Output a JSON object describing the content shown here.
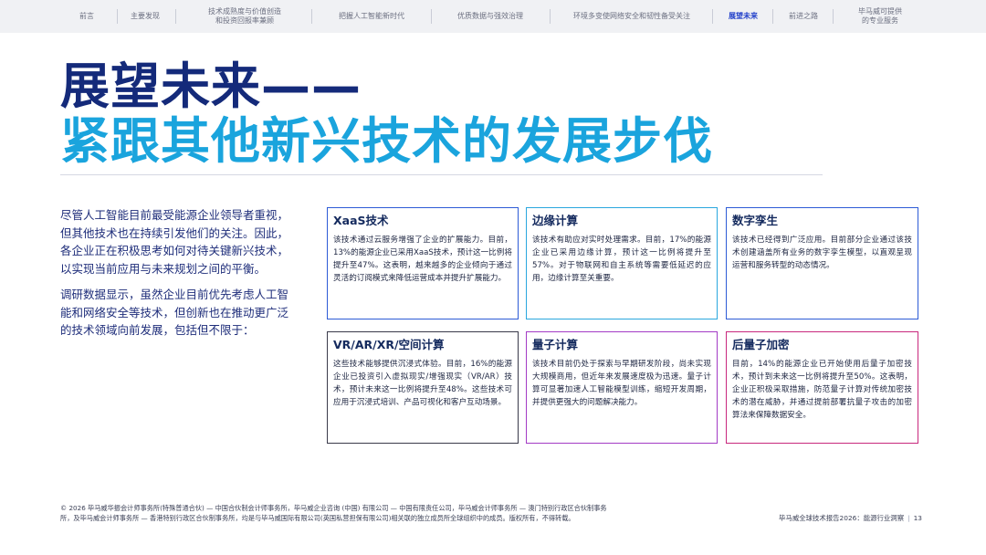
{
  "nav": {
    "items": [
      {
        "label": "前言",
        "active": false
      },
      {
        "label": "主要发现",
        "active": false
      },
      {
        "label": "技术成熟度与价值创造\n和投资回报率兼顾",
        "active": false
      },
      {
        "label": "把握人工智能新时代",
        "active": false
      },
      {
        "label": "优质数据与强效治理",
        "active": false
      },
      {
        "label": "环境多变使网络安全和韧性备受关注",
        "active": false
      },
      {
        "label": "展望未来",
        "active": true
      },
      {
        "label": "前进之路",
        "active": false
      },
      {
        "label": "毕马威可提供\n的专业服务",
        "active": false
      }
    ]
  },
  "heading": {
    "line1": "展望未来——",
    "line2": "紧跟其他新兴技术的发展步伐"
  },
  "intro": {
    "p1": "尽管人工智能目前最受能源企业领导者重视，但其他技术也在持续引发他们的关注。因此，各企业正在积极思考如何对待关键新兴技术，以实现当前应用与未来规划之间的平衡。",
    "p2": "调研数据显示，虽然企业目前优先考虑人工智能和网络安全等技术，但创新也在推动更广泛的技术领域向前发展，包括但不限于："
  },
  "cards": {
    "xaas": {
      "title": "XaaS技术",
      "body": "该技术通过云服务增强了企业的扩展能力。目前，13%的能源企业已采用XaaS技术，预计这一比例将提升至47%。这表明，越来越多的企业倾向于通过灵活的订阅模式来降低运营成本并提升扩展能力。"
    },
    "edge": {
      "title": "边缘计算",
      "body": "该技术有助应对实时处理需求。目前，17%的能源企业已采用边缘计算，预计这一比例将提升至57%。对于物联网和自主系统等需要低延迟的应用，边缘计算至关重要。"
    },
    "twin": {
      "title": "数字孪生",
      "body": "该技术已经得到广泛应用。目前部分企业通过该技术创建涵盖所有业务的数字孪生模型，以直观呈现运营和服务转型的动态情况。"
    },
    "vr": {
      "title": "VR/AR/XR/空间计算",
      "body": "这些技术能够提供沉浸式体验。目前，16%的能源企业已投资引入虚拟现实/增强现实（VR/AR）技术，预计未来这一比例将提升至48%。这些技术可应用于沉浸式培训、产品可视化和客户互动场景。"
    },
    "qc": {
      "title": "量子计算",
      "body": "该技术目前仍处于探索与早期研发阶段，尚未实现大规模商用，但近年来发展速度极为迅速。量子计算可显著加速人工智能模型训练，缩短开发周期，并提供更强大的问题解决能力。"
    },
    "pq": {
      "title": "后量子加密",
      "body": "目前，14%的能源企业已开始使用后量子加密技术，预计到未来这一比例将提升至50%。这表明，企业正积极采取措施，防范量子计算对传统加密技术的潜在威胁，并通过提前部署抗量子攻击的加密算法来保障数据安全。"
    }
  },
  "footer": {
    "legal": "© 2026 毕马威华振会计师事务所(特殊普通合伙) — 中国合伙制会计师事务所，毕马威企业咨询 (中国) 有限公司 — 中国有限责任公司，毕马威会计师事务所 — 澳门特别行政区合伙制事务所，及毕马威会计师事务所 — 香港特别行政区合伙制事务所，均是与毕马威国际有限公司(英国私营担保有限公司)相关联的独立成员所全球组织中的成员。版权所有，不得转载。",
    "report": "毕马威全球技术报告2026：能源行业洞察",
    "page": "13"
  }
}
